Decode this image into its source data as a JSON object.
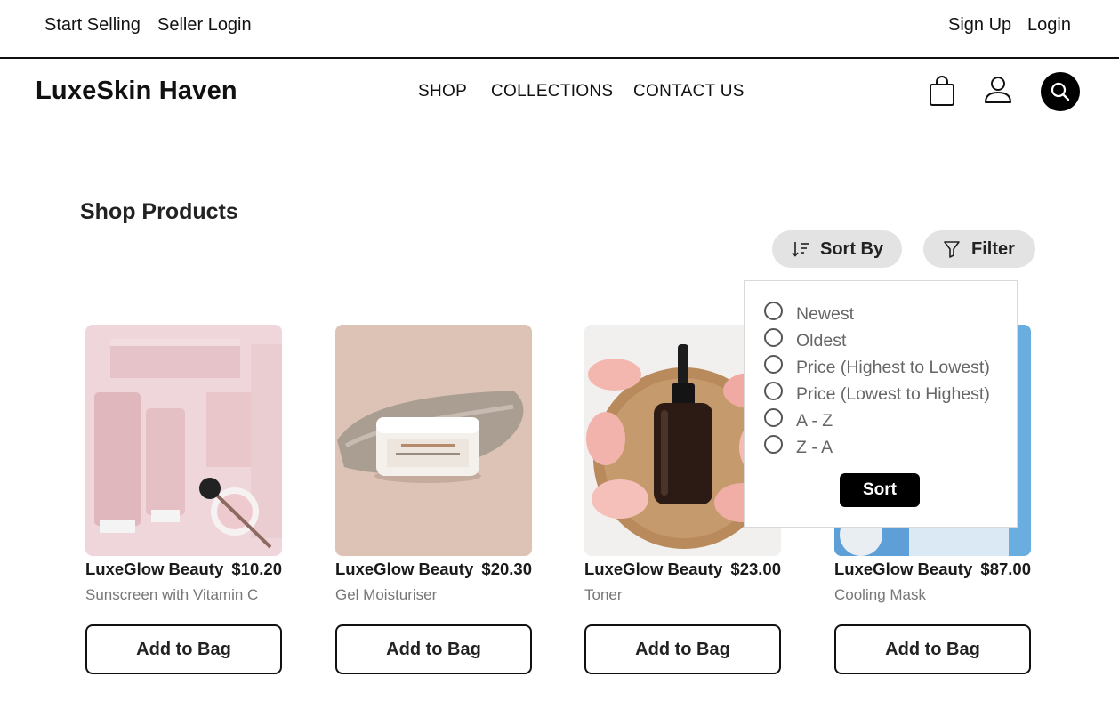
{
  "topbar": {
    "start_selling": "Start Selling",
    "seller_login": "Seller Login",
    "sign_up": "Sign Up",
    "login": "Login"
  },
  "header": {
    "brand": "LuxeSkin Haven",
    "nav": [
      "SHOP",
      "COLLECTIONS",
      "CONTACT US"
    ],
    "icons": [
      "shopping-bag-icon",
      "user-icon",
      "search-icon"
    ]
  },
  "section": {
    "title": "Shop Products",
    "sort_label": "Sort By",
    "filter_label": "Filter"
  },
  "products": [
    {
      "brand": "LuxeGlow Beauty",
      "price": "$10.20",
      "name": "Sunscreen with Vitamin C",
      "button": "Add to Bag"
    },
    {
      "brand": "LuxeGlow Beauty",
      "price": "$20.30",
      "name": "Gel Moisturiser",
      "button": "Add to Bag"
    },
    {
      "brand": "LuxeGlow Beauty",
      "price": "$23.00",
      "name": "Toner",
      "button": "Add to Bag"
    },
    {
      "brand": "LuxeGlow Beauty",
      "price": "$87.00",
      "name": "Cooling Mask",
      "button": "Add to Bag"
    }
  ],
  "sort_menu": {
    "options": [
      "Newest",
      "Oldest",
      "Price (Highest to Lowest)",
      "Price (Lowest to Highest)",
      "A - Z",
      "Z - A"
    ],
    "button": "Sort"
  },
  "colors": {
    "accent": "#000000",
    "pill_bg": "#e3e3e3",
    "muted_text": "#777777"
  }
}
